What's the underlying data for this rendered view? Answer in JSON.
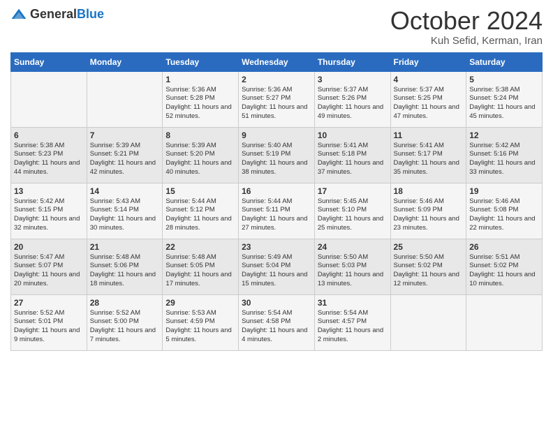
{
  "header": {
    "logo_general": "General",
    "logo_blue": "Blue",
    "month_title": "October 2024",
    "location": "Kuh Sefid, Kerman, Iran"
  },
  "days_of_week": [
    "Sunday",
    "Monday",
    "Tuesday",
    "Wednesday",
    "Thursday",
    "Friday",
    "Saturday"
  ],
  "weeks": [
    [
      {
        "day": "",
        "sunrise": "",
        "sunset": "",
        "daylight": ""
      },
      {
        "day": "",
        "sunrise": "",
        "sunset": "",
        "daylight": ""
      },
      {
        "day": "1",
        "sunrise": "Sunrise: 5:36 AM",
        "sunset": "Sunset: 5:28 PM",
        "daylight": "Daylight: 11 hours and 52 minutes."
      },
      {
        "day": "2",
        "sunrise": "Sunrise: 5:36 AM",
        "sunset": "Sunset: 5:27 PM",
        "daylight": "Daylight: 11 hours and 51 minutes."
      },
      {
        "day": "3",
        "sunrise": "Sunrise: 5:37 AM",
        "sunset": "Sunset: 5:26 PM",
        "daylight": "Daylight: 11 hours and 49 minutes."
      },
      {
        "day": "4",
        "sunrise": "Sunrise: 5:37 AM",
        "sunset": "Sunset: 5:25 PM",
        "daylight": "Daylight: 11 hours and 47 minutes."
      },
      {
        "day": "5",
        "sunrise": "Sunrise: 5:38 AM",
        "sunset": "Sunset: 5:24 PM",
        "daylight": "Daylight: 11 hours and 45 minutes."
      }
    ],
    [
      {
        "day": "6",
        "sunrise": "Sunrise: 5:38 AM",
        "sunset": "Sunset: 5:23 PM",
        "daylight": "Daylight: 11 hours and 44 minutes."
      },
      {
        "day": "7",
        "sunrise": "Sunrise: 5:39 AM",
        "sunset": "Sunset: 5:21 PM",
        "daylight": "Daylight: 11 hours and 42 minutes."
      },
      {
        "day": "8",
        "sunrise": "Sunrise: 5:39 AM",
        "sunset": "Sunset: 5:20 PM",
        "daylight": "Daylight: 11 hours and 40 minutes."
      },
      {
        "day": "9",
        "sunrise": "Sunrise: 5:40 AM",
        "sunset": "Sunset: 5:19 PM",
        "daylight": "Daylight: 11 hours and 38 minutes."
      },
      {
        "day": "10",
        "sunrise": "Sunrise: 5:41 AM",
        "sunset": "Sunset: 5:18 PM",
        "daylight": "Daylight: 11 hours and 37 minutes."
      },
      {
        "day": "11",
        "sunrise": "Sunrise: 5:41 AM",
        "sunset": "Sunset: 5:17 PM",
        "daylight": "Daylight: 11 hours and 35 minutes."
      },
      {
        "day": "12",
        "sunrise": "Sunrise: 5:42 AM",
        "sunset": "Sunset: 5:16 PM",
        "daylight": "Daylight: 11 hours and 33 minutes."
      }
    ],
    [
      {
        "day": "13",
        "sunrise": "Sunrise: 5:42 AM",
        "sunset": "Sunset: 5:15 PM",
        "daylight": "Daylight: 11 hours and 32 minutes."
      },
      {
        "day": "14",
        "sunrise": "Sunrise: 5:43 AM",
        "sunset": "Sunset: 5:14 PM",
        "daylight": "Daylight: 11 hours and 30 minutes."
      },
      {
        "day": "15",
        "sunrise": "Sunrise: 5:44 AM",
        "sunset": "Sunset: 5:12 PM",
        "daylight": "Daylight: 11 hours and 28 minutes."
      },
      {
        "day": "16",
        "sunrise": "Sunrise: 5:44 AM",
        "sunset": "Sunset: 5:11 PM",
        "daylight": "Daylight: 11 hours and 27 minutes."
      },
      {
        "day": "17",
        "sunrise": "Sunrise: 5:45 AM",
        "sunset": "Sunset: 5:10 PM",
        "daylight": "Daylight: 11 hours and 25 minutes."
      },
      {
        "day": "18",
        "sunrise": "Sunrise: 5:46 AM",
        "sunset": "Sunset: 5:09 PM",
        "daylight": "Daylight: 11 hours and 23 minutes."
      },
      {
        "day": "19",
        "sunrise": "Sunrise: 5:46 AM",
        "sunset": "Sunset: 5:08 PM",
        "daylight": "Daylight: 11 hours and 22 minutes."
      }
    ],
    [
      {
        "day": "20",
        "sunrise": "Sunrise: 5:47 AM",
        "sunset": "Sunset: 5:07 PM",
        "daylight": "Daylight: 11 hours and 20 minutes."
      },
      {
        "day": "21",
        "sunrise": "Sunrise: 5:48 AM",
        "sunset": "Sunset: 5:06 PM",
        "daylight": "Daylight: 11 hours and 18 minutes."
      },
      {
        "day": "22",
        "sunrise": "Sunrise: 5:48 AM",
        "sunset": "Sunset: 5:05 PM",
        "daylight": "Daylight: 11 hours and 17 minutes."
      },
      {
        "day": "23",
        "sunrise": "Sunrise: 5:49 AM",
        "sunset": "Sunset: 5:04 PM",
        "daylight": "Daylight: 11 hours and 15 minutes."
      },
      {
        "day": "24",
        "sunrise": "Sunrise: 5:50 AM",
        "sunset": "Sunset: 5:03 PM",
        "daylight": "Daylight: 11 hours and 13 minutes."
      },
      {
        "day": "25",
        "sunrise": "Sunrise: 5:50 AM",
        "sunset": "Sunset: 5:02 PM",
        "daylight": "Daylight: 11 hours and 12 minutes."
      },
      {
        "day": "26",
        "sunrise": "Sunrise: 5:51 AM",
        "sunset": "Sunset: 5:02 PM",
        "daylight": "Daylight: 11 hours and 10 minutes."
      }
    ],
    [
      {
        "day": "27",
        "sunrise": "Sunrise: 5:52 AM",
        "sunset": "Sunset: 5:01 PM",
        "daylight": "Daylight: 11 hours and 9 minutes."
      },
      {
        "day": "28",
        "sunrise": "Sunrise: 5:52 AM",
        "sunset": "Sunset: 5:00 PM",
        "daylight": "Daylight: 11 hours and 7 minutes."
      },
      {
        "day": "29",
        "sunrise": "Sunrise: 5:53 AM",
        "sunset": "Sunset: 4:59 PM",
        "daylight": "Daylight: 11 hours and 5 minutes."
      },
      {
        "day": "30",
        "sunrise": "Sunrise: 5:54 AM",
        "sunset": "Sunset: 4:58 PM",
        "daylight": "Daylight: 11 hours and 4 minutes."
      },
      {
        "day": "31",
        "sunrise": "Sunrise: 5:54 AM",
        "sunset": "Sunset: 4:57 PM",
        "daylight": "Daylight: 11 hours and 2 minutes."
      },
      {
        "day": "",
        "sunrise": "",
        "sunset": "",
        "daylight": ""
      },
      {
        "day": "",
        "sunrise": "",
        "sunset": "",
        "daylight": ""
      }
    ]
  ]
}
